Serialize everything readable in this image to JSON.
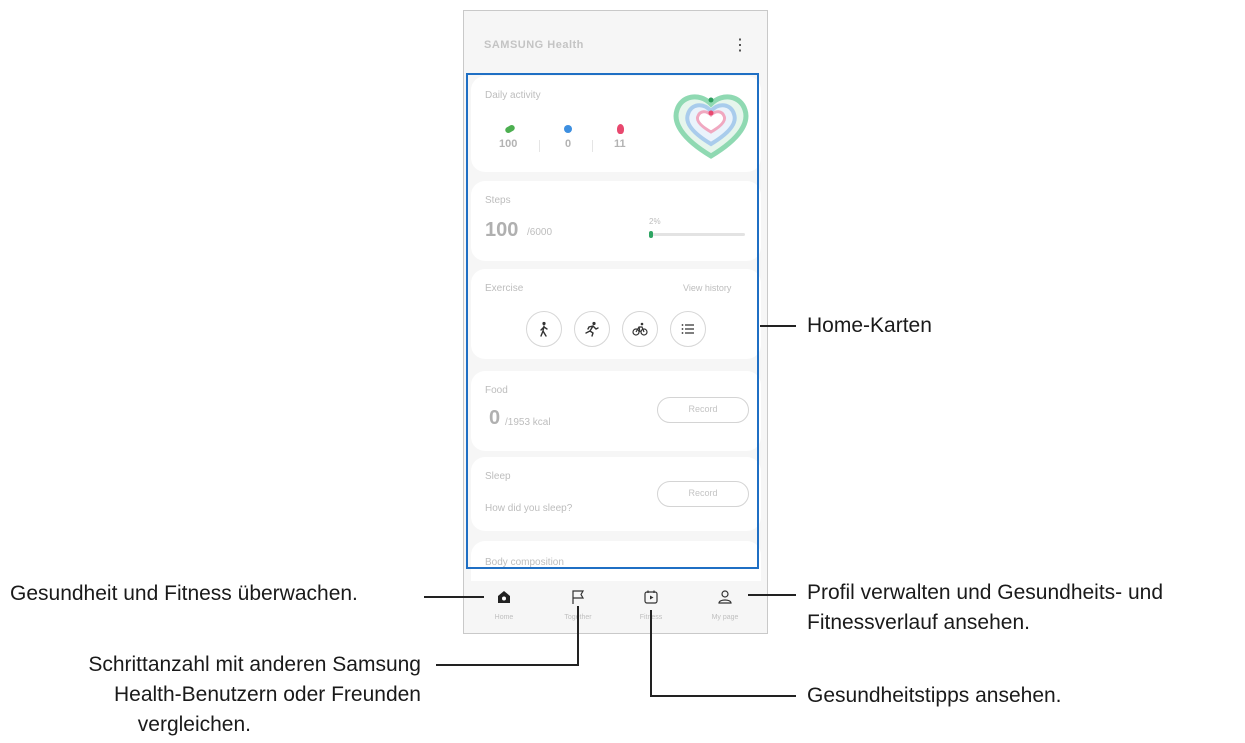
{
  "app": {
    "title": "SAMSUNG Health",
    "more_icon": "more-vert-icon"
  },
  "daily_activity": {
    "title": "Daily activity",
    "stats": [
      {
        "icon": "steps-shoe-icon",
        "color": "#4caf50",
        "value": "100"
      },
      {
        "icon": "clock-dot-icon",
        "color": "#3d8fe0",
        "value": "0"
      },
      {
        "icon": "flame-icon",
        "color": "#e8486e",
        "value": "11"
      }
    ],
    "rings_colors": [
      "#7fd6a6",
      "#5aa8e6",
      "#e8486e"
    ]
  },
  "steps": {
    "title": "Steps",
    "value": "100",
    "goal": "/6000",
    "percent_label": "2%",
    "progress": 0.02
  },
  "exercise": {
    "title": "Exercise",
    "view_history": "View history",
    "buttons": [
      "walk-icon",
      "run-icon",
      "bike-icon",
      "list-icon"
    ]
  },
  "food": {
    "title": "Food",
    "value": "0",
    "goal": "/1953 kcal",
    "record_label": "Record"
  },
  "sleep": {
    "title": "Sleep",
    "prompt": "How did you sleep?",
    "record_label": "Record"
  },
  "body_composition": {
    "title": "Body composition"
  },
  "navbar": {
    "items": [
      {
        "icon": "home-icon",
        "label": "Home"
      },
      {
        "icon": "flag-icon",
        "label": "Together"
      },
      {
        "icon": "fitness-play-icon",
        "label": "Fitness"
      },
      {
        "icon": "person-icon",
        "label": "My page"
      }
    ]
  },
  "callouts": {
    "home_cards": "Home-Karten",
    "monitor": "Gesundheit und Fitness überwachen.",
    "profile_line1": "Profil verwalten und Gesundheits- und",
    "profile_line2": "Fitnessverlauf ansehen.",
    "compare_line1": "Schrittanzahl mit anderen Samsung",
    "compare_line2": "Health-Benutzern oder Freunden",
    "compare_line3": "vergleichen.",
    "tips": "Gesundheitstipps ansehen."
  }
}
